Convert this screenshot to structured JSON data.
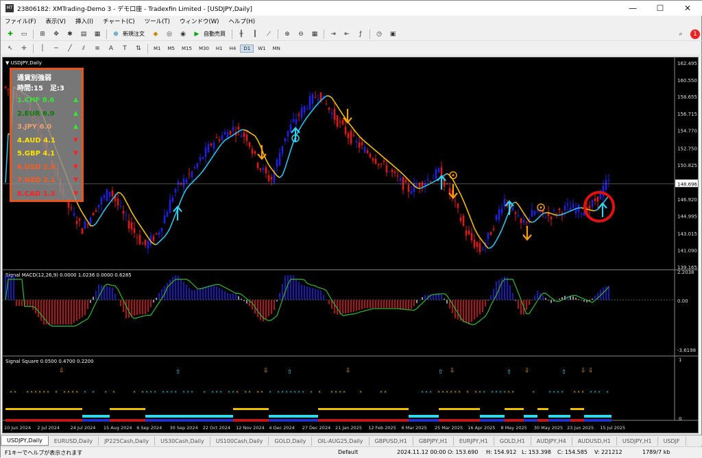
{
  "window": {
    "title": "23806182: XMTrading-Demo 3 - デモ口座 - Tradexfin Limited - [USDJPY,Daily]",
    "minimize": "—",
    "maximize": "☐",
    "close": "✕"
  },
  "menu": [
    "ファイル(F)",
    "表示(V)",
    "挿入(I)",
    "チャート(C)",
    "ツール(T)",
    "ウィンドウ(W)",
    "ヘルプ(H)"
  ],
  "toolbar": {
    "new_order": "新規注文",
    "auto_trade": "自動売買",
    "notify_count": "1"
  },
  "timeframes": [
    "M1",
    "M5",
    "M15",
    "M30",
    "H1",
    "H4",
    "D1",
    "W1",
    "MN"
  ],
  "active_timeframe": "D1",
  "main_chart": {
    "label": "USDJPY,Daily",
    "price_scale": [
      "162.495",
      "160.550",
      "158.655",
      "156.715",
      "154.770",
      "152.750",
      "150.825",
      "148.696",
      "146.920",
      "144.995",
      "143.015",
      "141.090",
      "139.165"
    ],
    "current_price": "148.696"
  },
  "strength_panel": {
    "title": "通貨別強弱",
    "subtitle": "時間:15　足:3",
    "rows": [
      {
        "text": "1.CHF 8.6",
        "color": "#35e635",
        "arrow": "▲",
        "arrow_color": "#35e635"
      },
      {
        "text": "2.EUR 6.9",
        "color": "#0a7d0a",
        "arrow": "▲",
        "arrow_color": "#35e635"
      },
      {
        "text": "3.JPY  6.0",
        "color": "#f0a070",
        "arrow": "▲",
        "arrow_color": "#35e635"
      },
      {
        "text": "4.AUD 4.1",
        "color": "#ffe000",
        "arrow": "▼",
        "arrow_color": "#ff2020"
      },
      {
        "text": "5.GBP 4.1",
        "color": "#ffe000",
        "arrow": "▼",
        "arrow_color": "#ff2020"
      },
      {
        "text": "6.USD 2.9",
        "color": "#ff5a1e",
        "arrow": "▼",
        "arrow_color": "#ff2020"
      },
      {
        "text": "7.NZD  2.1",
        "color": "#ff5a1e",
        "arrow": "▼",
        "arrow_color": "#ff2020"
      },
      {
        "text": "8.CAD 1.3",
        "color": "#ff2020",
        "arrow": "▼",
        "arrow_color": "#ff2020"
      }
    ]
  },
  "macd": {
    "label": "Signal MACD(12,26,9) 0.0000 1.0236 0.0000 0.6285",
    "scale": [
      "2.2038",
      "0.00",
      "-3.6198"
    ]
  },
  "square": {
    "label": "Signal Square 0.0500 0.4700 0.2200",
    "scale": [
      "1",
      "0"
    ]
  },
  "dates": [
    "10 Jun 2024",
    "2 Jul 2024",
    "24 Jul 2024",
    "15 Aug 2024",
    "6 Sep 2024",
    "30 Sep 2024",
    "22 Oct 2024",
    "12 Nov 2024",
    "4 Dec 2024",
    "27 Dec 2024",
    "21 Jan 2025",
    "12 Feb 2025",
    "6 Mar 2025",
    "25 Mar 2025",
    "16 Apr 2025",
    "8 May 2025",
    "30 May 2025",
    "23 Jun 2025",
    "15 Jul 2025"
  ],
  "tabs": [
    "USDJPY,Daily",
    "EURUSD,Daily",
    "JP225Cash,Daily",
    "US30Cash,Daily",
    "US100Cash,Daily",
    "GOLD,Daily",
    "OIL-AUG25,Daily",
    "GBPUSD,H1",
    "GBPJPY,H1",
    "EURJPY,H1",
    "GOLD,H1",
    "AUDJPY,H4",
    "AUDUSD,H1",
    "USDJPY,H1",
    "USDJF"
  ],
  "status": {
    "help": "F1キーでヘルプが表示されます",
    "profile": "Default",
    "datetime": "2024.11.12 00:00",
    "open": "O: 153.690",
    "high": "H: 154.912",
    "low": "L: 153.398",
    "close": "C: 154.585",
    "volume": "V: 221212",
    "traffic": "1789/7 kb"
  },
  "colors": {
    "bull": "#2020e0",
    "bear": "#e01818",
    "ma_up": "#29c5f0",
    "ma_down": "#f5c000",
    "signal_up": "#35d0f0",
    "signal_down": "#f5a000",
    "highlight": "#e01010"
  }
}
